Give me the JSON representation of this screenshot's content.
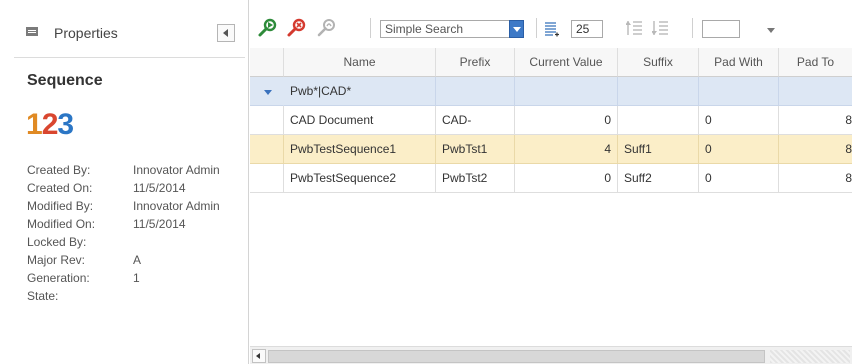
{
  "sidebar": {
    "title": "Properties",
    "item_type": "Sequence",
    "type_icon": {
      "d1": "1",
      "d2": "2",
      "d3": "3"
    },
    "props": [
      {
        "key": "Created By:",
        "value": "Innovator Admin"
      },
      {
        "key": "Created On:",
        "value": "11/5/2014"
      },
      {
        "key": "Modified By:",
        "value": "Innovator Admin"
      },
      {
        "key": "Modified On:",
        "value": "11/5/2014"
      },
      {
        "key": "Locked By:",
        "value": ""
      },
      {
        "key": "Major Rev:",
        "value": "A"
      },
      {
        "key": "Generation:",
        "value": "1"
      },
      {
        "key": "State:",
        "value": ""
      }
    ]
  },
  "toolbar": {
    "icons": [
      "run-search-icon",
      "clear-search-icon",
      "saved-search-icon",
      "page-size-icon",
      "prev-page-icon",
      "next-page-icon"
    ],
    "search_mode": "Simple Search",
    "page_size": "25",
    "filter_value": ""
  },
  "grid": {
    "columns": [
      "",
      "Name",
      "Prefix",
      "Current Value",
      "Suffix",
      "Pad With",
      "Pad To"
    ],
    "group_label": "Pwb*|CAD*",
    "rows": [
      {
        "name": "CAD Document",
        "prefix": "CAD-",
        "current_value": "0",
        "suffix": "",
        "pad_with": "0",
        "pad_to": "8"
      },
      {
        "name": "PwbTestSequence1",
        "prefix": "PwbTst1",
        "current_value": "4",
        "suffix": "Suff1",
        "pad_with": "0",
        "pad_to": "8"
      },
      {
        "name": "PwbTestSequence2",
        "prefix": "PwbTst2",
        "current_value": "0",
        "suffix": "Suff2",
        "pad_with": "0",
        "pad_to": "8"
      }
    ]
  },
  "colors": {
    "selected_row": "#fbeec8",
    "group_row": "#dde7f4",
    "accent": "#3d79c7",
    "search_green": "#2e8b3a",
    "clear_red": "#d43a2f"
  }
}
